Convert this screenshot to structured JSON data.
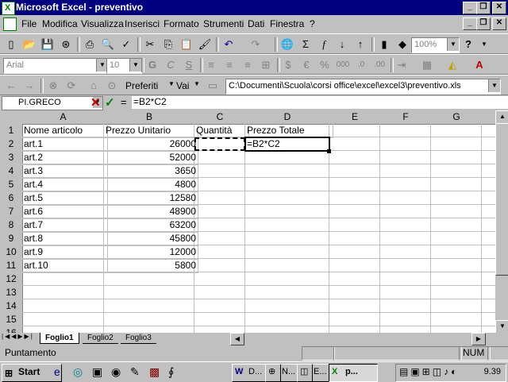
{
  "window": {
    "title": "Microsoft Excel - preventivo"
  },
  "menu": [
    "File",
    "Modifica",
    "Visualizza",
    "Inserisci",
    "Formato",
    "Strumenti",
    "Dati",
    "Finestra",
    "?"
  ],
  "format_toolbar": {
    "font": "Arial",
    "size": "10",
    "bold": "G",
    "italic": "C",
    "underline": "S",
    "zoom": "100%"
  },
  "web_toolbar": {
    "favorites": "Preferiti",
    "goto": "Vai",
    "address": "C:\\Documenti\\Scuola\\corsi office\\excel\\excel3\\preventivo.xls"
  },
  "formula_bar": {
    "name_box": "PI.GRECO",
    "formula": "=B2*C2"
  },
  "columns": [
    "A",
    "B",
    "C",
    "D",
    "E",
    "F",
    "G"
  ],
  "rows": [
    "1",
    "2",
    "3",
    "4",
    "5",
    "6",
    "7",
    "8",
    "9",
    "10",
    "11",
    "12",
    "13",
    "14",
    "15",
    "16"
  ],
  "headers": {
    "a": "Nome articolo",
    "b": "Prezzo Unitario",
    "c": "Quantità",
    "d": "Prezzo Totale"
  },
  "items": [
    {
      "name": "art.1",
      "price": "26000"
    },
    {
      "name": "art.2",
      "price": "52000"
    },
    {
      "name": "art.3",
      "price": "3650"
    },
    {
      "name": "art.4",
      "price": "4800"
    },
    {
      "name": "art.5",
      "price": "12580"
    },
    {
      "name": "art.6",
      "price": "48900"
    },
    {
      "name": "art.7",
      "price": "63200"
    },
    {
      "name": "art.8",
      "price": "45800"
    },
    {
      "name": "art.9",
      "price": "12000"
    },
    {
      "name": "art.10",
      "price": "5800"
    }
  ],
  "active_cell_text": "=B2*C2",
  "sheets": [
    "Foglio1",
    "Foglio2",
    "Foglio3"
  ],
  "status": {
    "mode": "Puntamento",
    "num": "NUM"
  },
  "taskbar": {
    "start": "Start",
    "items": [
      "D...",
      "N...",
      "E...",
      "p..."
    ],
    "clock": "9.39"
  }
}
